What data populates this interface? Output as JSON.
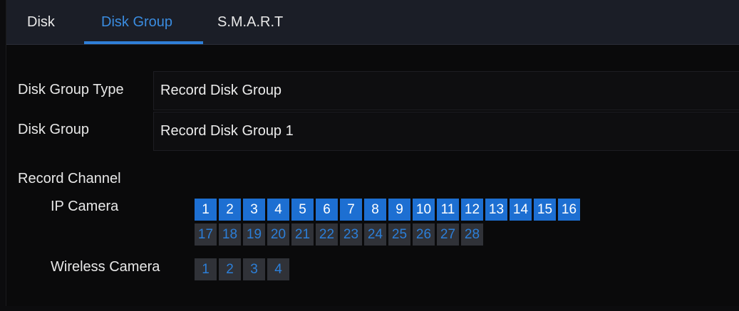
{
  "tabs": [
    {
      "label": "Disk",
      "active": false
    },
    {
      "label": "Disk Group",
      "active": true
    },
    {
      "label": "S.M.A.R.T",
      "active": false
    }
  ],
  "form": {
    "disk_group_type_label": "Disk Group Type",
    "disk_group_type_value": "Record Disk Group",
    "disk_group_label": "Disk Group",
    "disk_group_value": "Record Disk Group 1",
    "record_channel_label": "Record Channel"
  },
  "channels": {
    "ip_camera_label": "IP Camera",
    "ip_camera_row1": [
      {
        "num": "1",
        "selected": true
      },
      {
        "num": "2",
        "selected": true
      },
      {
        "num": "3",
        "selected": true
      },
      {
        "num": "4",
        "selected": true
      },
      {
        "num": "5",
        "selected": true
      },
      {
        "num": "6",
        "selected": true
      },
      {
        "num": "7",
        "selected": true
      },
      {
        "num": "8",
        "selected": true
      },
      {
        "num": "9",
        "selected": true
      },
      {
        "num": "10",
        "selected": true
      },
      {
        "num": "11",
        "selected": true
      },
      {
        "num": "12",
        "selected": true
      },
      {
        "num": "13",
        "selected": true
      },
      {
        "num": "14",
        "selected": true
      },
      {
        "num": "15",
        "selected": true
      },
      {
        "num": "16",
        "selected": true
      }
    ],
    "ip_camera_row2": [
      {
        "num": "17",
        "selected": false
      },
      {
        "num": "18",
        "selected": false
      },
      {
        "num": "19",
        "selected": false
      },
      {
        "num": "20",
        "selected": false
      },
      {
        "num": "21",
        "selected": false
      },
      {
        "num": "22",
        "selected": false
      },
      {
        "num": "23",
        "selected": false
      },
      {
        "num": "24",
        "selected": false
      },
      {
        "num": "25",
        "selected": false
      },
      {
        "num": "26",
        "selected": false
      },
      {
        "num": "27",
        "selected": false
      },
      {
        "num": "28",
        "selected": false
      }
    ],
    "wireless_camera_label": "Wireless Camera",
    "wireless_camera": [
      {
        "num": "1",
        "selected": false
      },
      {
        "num": "2",
        "selected": false
      },
      {
        "num": "3",
        "selected": false
      },
      {
        "num": "4",
        "selected": false
      }
    ]
  },
  "colors": {
    "accent": "#2f7fd8",
    "channel_selected_bg": "#1d6fd2",
    "channel_unselected_bg": "#303238",
    "channel_unselected_text": "#2c7fd9"
  }
}
